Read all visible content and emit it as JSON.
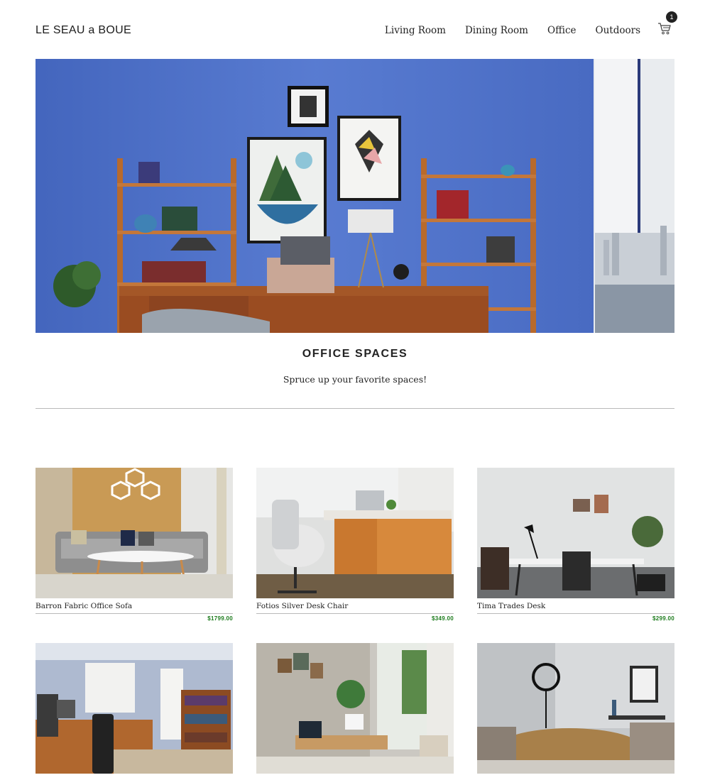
{
  "header": {
    "brand": "LE SEAU a BOUE",
    "nav": [
      "Living Room",
      "Dining Room",
      "Office",
      "Outdoors"
    ],
    "cart_count": "1",
    "cart_icon": "cart-icon"
  },
  "hero": {
    "image": "office-workspace-photo"
  },
  "section": {
    "title": "OFFICE SPACES",
    "subtitle": "Spruce up your favorite spaces!"
  },
  "products": [
    {
      "name": "Barron Fabric Office Sofa",
      "price": "$1799.00"
    },
    {
      "name": "Fotios Silver Desk Chair",
      "price": "$349.00"
    },
    {
      "name": "Tima Trades Desk",
      "price": "$299.00"
    },
    {
      "name": "",
      "price": ""
    },
    {
      "name": "",
      "price": ""
    },
    {
      "name": "",
      "price": ""
    }
  ],
  "colors": {
    "accent_price": "#1e7c1e",
    "text": "#1c1c1c",
    "divider": "#b9b9b9"
  }
}
